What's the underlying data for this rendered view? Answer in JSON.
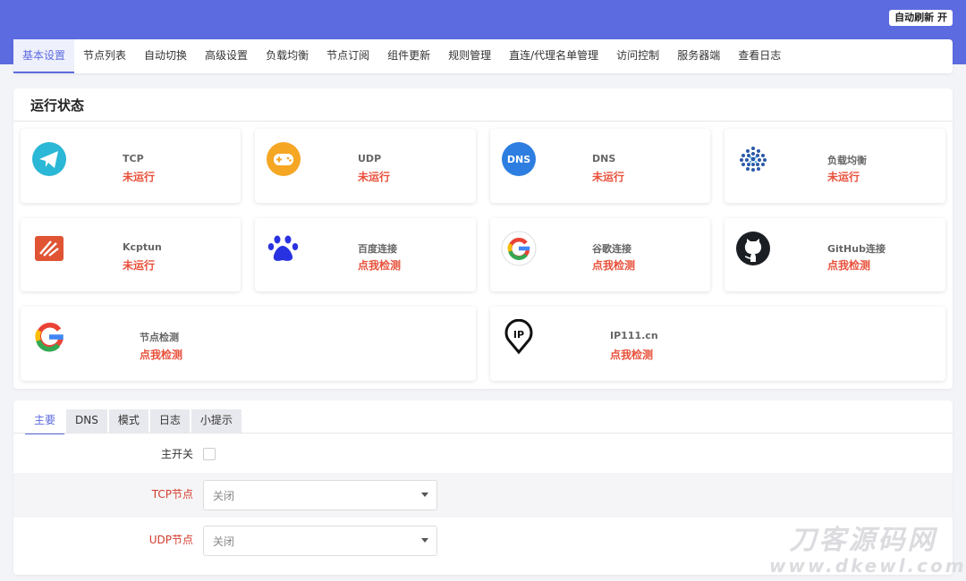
{
  "header": {
    "refresh_button": "自动刷新 开"
  },
  "tabs": [
    "基本设置",
    "节点列表",
    "自动切换",
    "高级设置",
    "负载均衡",
    "节点订阅",
    "组件更新",
    "规则管理",
    "直连/代理名单管理",
    "访问控制",
    "服务器端",
    "查看日志"
  ],
  "status_panel": {
    "title": "运行状态",
    "cards": [
      {
        "name": "TCP",
        "status": "未运行",
        "icon": "telegram-icon"
      },
      {
        "name": "UDP",
        "status": "未运行",
        "icon": "gamepad-icon"
      },
      {
        "name": "DNS",
        "status": "未运行",
        "icon": "dns-icon",
        "icon_text": "DNS"
      },
      {
        "name": "负载均衡",
        "status": "未运行",
        "icon": "load-balance-icon"
      },
      {
        "name": "Kcptun",
        "status": "未运行",
        "icon": "kcptun-icon"
      },
      {
        "name": "百度连接",
        "status": "点我检测",
        "icon": "baidu-icon"
      },
      {
        "name": "谷歌连接",
        "status": "点我检测",
        "icon": "google-icon"
      },
      {
        "name": "GitHub连接",
        "status": "点我检测",
        "icon": "github-icon"
      },
      {
        "name": "节点检测",
        "status": "点我检测",
        "icon": "google-icon"
      },
      {
        "name": "IP111.cn",
        "status": "点我检测",
        "icon": "ip-pin-icon",
        "icon_text": "IP"
      }
    ]
  },
  "settings": {
    "subtabs": [
      "主要",
      "DNS",
      "模式",
      "日志",
      "小提示"
    ],
    "main_switch_label": "主开关",
    "tcp_label": "TCP节点",
    "tcp_value": "关闭",
    "udp_label": "UDP节点",
    "udp_value": "关闭"
  },
  "watermark": {
    "title": "刀客源码网",
    "url": "www.dkewl.com"
  },
  "colors": {
    "accent": "#5c6bdf",
    "status_red": "#e8503a",
    "label_red": "#d43c2c"
  }
}
